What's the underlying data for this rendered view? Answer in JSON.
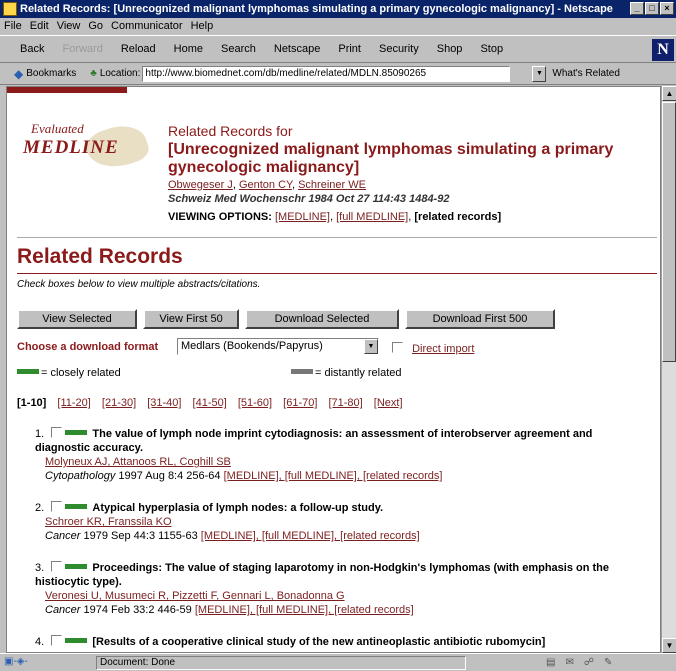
{
  "window": {
    "title": "Related Records: [Unrecognized malignant lymphomas simulating a primary gynecologic malignancy] - Netscape",
    "min": "_",
    "max": "□",
    "close": "×"
  },
  "menu": [
    "File",
    "Edit",
    "View",
    "Go",
    "Communicator",
    "Help"
  ],
  "toolbar": [
    "Back",
    "Forward",
    "Reload",
    "Home",
    "Search",
    "Netscape",
    "Print",
    "Security",
    "Shop",
    "Stop"
  ],
  "location": {
    "bookmarks": "Bookmarks",
    "label": "Location:",
    "url": "http://www.biomednet.com/db/medline/related/MDLN.85090265",
    "whats_related": "What's Related"
  },
  "logo": {
    "line1": "Evaluated",
    "line2": "MEDLINE"
  },
  "header": {
    "for": "Related Records for",
    "title": "[Unrecognized malignant lymphomas simulating a primary gynecologic malignancy]",
    "authors": [
      "Obwegeser J",
      "Genton CY",
      "Schreiner WE"
    ],
    "journal": "Schweiz Med Wochenschr 1984 Oct 27 114:43 1484-92",
    "viewing_label": "VIEWING OPTIONS:",
    "viewing_medline": "[MEDLINE]",
    "viewing_full": "[full MEDLINE]",
    "viewing_related": "[related records]"
  },
  "related": {
    "title": "Related Records",
    "subtitle": "Check boxes below to view multiple abstracts/citations."
  },
  "buttons": {
    "view_selected": "View Selected",
    "view_first": "View First 50",
    "download_selected": "Download Selected",
    "download_first": "Download First 500"
  },
  "download": {
    "label": "Choose a download format",
    "format": "Medlars (Bookends/Papyrus)",
    "direct_import": "Direct import"
  },
  "legend": {
    "close": "= closely related",
    "distant": "= distantly related"
  },
  "pager": [
    "[1-10]",
    "[11-20]",
    "[21-30]",
    "[31-40]",
    "[41-50]",
    "[51-60]",
    "[61-70]",
    "[71-80]",
    "[Next]"
  ],
  "records": [
    {
      "num": "1.",
      "title": "The value of lymph node imprint cytodiagnosis: an assessment of interobserver agreement and diagnostic accuracy.",
      "authors": "Molyneux AJ, Attanoos RL, Coghill SB",
      "journal": "Cytopathology",
      "cite": "1997 Aug 8:4 256-64",
      "links": "[MEDLINE], [full MEDLINE], [related records]"
    },
    {
      "num": "2.",
      "title": "Atypical hyperplasia of lymph nodes: a follow-up study.",
      "authors": "Schroer KR, Franssila KO",
      "journal": "Cancer",
      "cite": "1979 Sep 44:3 1155-63",
      "links": "[MEDLINE], [full MEDLINE], [related records]"
    },
    {
      "num": "3.",
      "title": "Proceedings: The value of staging laparotomy in non-Hodgkin's lymphomas (with emphasis on the histiocytic type).",
      "authors": "Veronesi U, Musumeci R, Pizzetti F, Gennari L, Bonadonna G",
      "journal": "Cancer",
      "cite": "1974 Feb 33:2 446-59",
      "links": "[MEDLINE], [full MEDLINE], [related records]"
    },
    {
      "num": "4.",
      "title": "[Results of a cooperative clinical study of the new antineoplastic antibiotic rubomycin]",
      "authors": "",
      "journal": "",
      "cite": "",
      "links": ""
    }
  ],
  "status": {
    "text": "Document: Done"
  }
}
